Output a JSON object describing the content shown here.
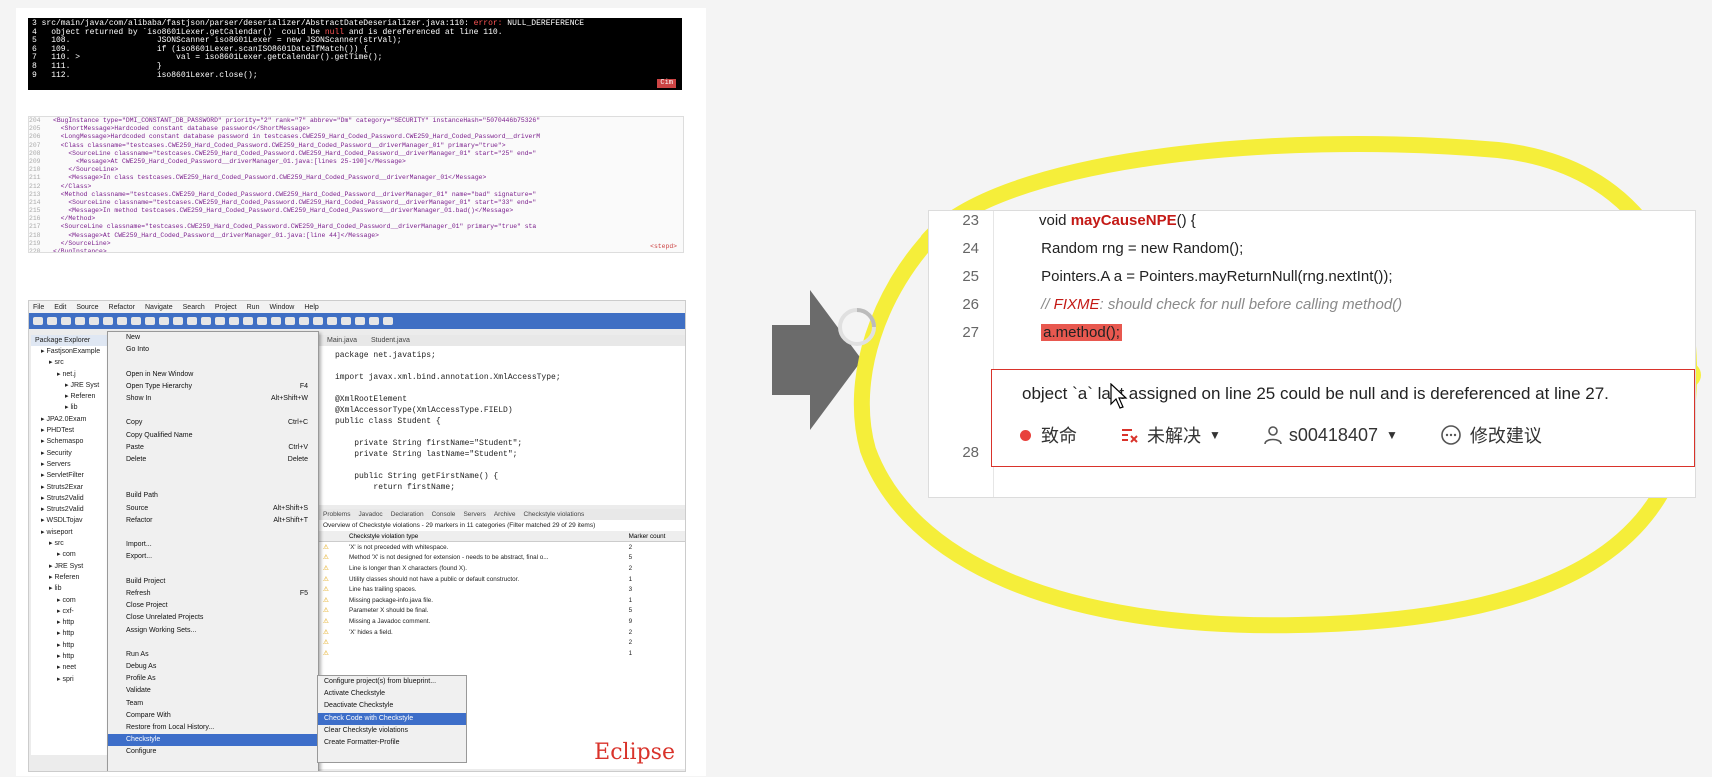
{
  "terminal": {
    "lines": [
      [
        "3",
        "src/main/java/com/alibaba/fastjson/parser/deserializer/AbstractDateDeserializer.java:110: ",
        "error:",
        " NULL_DEREFERENCE"
      ],
      [
        "4",
        "  object returned by `iso8601Lexer.getCalendar()` could be ",
        "null",
        " and is dereferenced at line 110."
      ],
      [
        "5",
        "  108.                  JSONScanner iso8601Lexer = new JSONScanner(strVal);",
        "",
        ""
      ],
      [
        "6",
        "  109.                  if (iso8601Lexer.scanISO8601DateIfMatch()) {",
        "",
        ""
      ],
      [
        "7",
        "  110. >                    val = iso8601Lexer.getCalendar().getTime();",
        "",
        ""
      ],
      [
        "8",
        "  111.                  }",
        "",
        ""
      ],
      [
        "9",
        "  112.                  iso8601Lexer.close();",
        "",
        ""
      ]
    ],
    "badge": "Cim"
  },
  "xml": {
    "lines": [
      [
        "204",
        "<BugInstance type=\"DMI_CONSTANT_DB_PASSWORD\" priority=\"2\" rank=\"7\" abbrev=\"Dm\" category=\"SECURITY\" instanceHash=\"5070446b75326\""
      ],
      [
        "205",
        "  <ShortMessage>Hardcoded constant database password</ShortMessage>"
      ],
      [
        "206",
        "  <LongMessage>Hardcoded constant database password in testcases.CWE259_Hard_Coded_Password.CWE259_Hard_Coded_Password__driverM"
      ],
      [
        "207",
        "  <Class classname=\"testcases.CWE259_Hard_Coded_Password.CWE259_Hard_Coded_Password__driverManager_01\" primary=\"true\">"
      ],
      [
        "208",
        "    <SourceLine classname=\"testcases.CWE259_Hard_Coded_Password.CWE259_Hard_Coded_Password__driverManager_01\" start=\"25\" end=\""
      ],
      [
        "209",
        "      <Message>At CWE259_Hard_Coded_Password__driverManager_01.java:[lines 25-190]</Message>"
      ],
      [
        "210",
        "    </SourceLine>"
      ],
      [
        "211",
        "    <Message>In class testcases.CWE259_Hard_Coded_Password.CWE259_Hard_Coded_Password__driverManager_01</Message>"
      ],
      [
        "212",
        "  </Class>"
      ],
      [
        "213",
        "  <Method classname=\"testcases.CWE259_Hard_Coded_Password.CWE259_Hard_Coded_Password__driverManager_01\" name=\"bad\" signature=\""
      ],
      [
        "214",
        "    <SourceLine classname=\"testcases.CWE259_Hard_Coded_Password.CWE259_Hard_Coded_Password__driverManager_01\" start=\"33\" end=\""
      ],
      [
        "215",
        "    <Message>In method testcases.CWE259_Hard_Coded_Password.CWE259_Hard_Coded_Password__driverManager_01.bad()</Message>"
      ],
      [
        "216",
        "  </Method>"
      ],
      [
        "217",
        "  <SourceLine classname=\"testcases.CWE259_Hard_Coded_Password.CWE259_Hard_Coded_Password__driverManager_01\" primary=\"true\" sta"
      ],
      [
        "218",
        "    <Message>At CWE259_Hard_Coded_Password__driverManager_01.java:[line 44]</Message>"
      ],
      [
        "219",
        "  </SourceLine>"
      ],
      [
        "220",
        "</BugInstance>"
      ]
    ],
    "trailing": "<stepd>"
  },
  "eclipse": {
    "menubar": [
      "File",
      "Edit",
      "Source",
      "Refactor",
      "Navigate",
      "Search",
      "Project",
      "Run",
      "Window",
      "Help"
    ],
    "package_explorer_title": "Package Explorer",
    "tree": [
      "FastjsonExample",
      "src",
      "net.j",
      "JRE Syst",
      "Referen",
      "lib",
      "JPA2.0Exam",
      "PHDTest",
      "Schemaspo",
      "Security",
      "Servers",
      "ServletFilter",
      "Struts2Exar",
      "Struts2Valid",
      "Struts2Valid",
      "WSDLTojav",
      "wiseport",
      "src",
      "com",
      "JRE Syst",
      "Referen",
      "lib",
      "com",
      "cxf-",
      "http",
      "http",
      "http",
      "http",
      "neet",
      "spri"
    ],
    "context_menu": [
      [
        "New",
        ""
      ],
      [
        "Go Into",
        ""
      ],
      [
        "",
        ""
      ],
      [
        "Open in New Window",
        ""
      ],
      [
        "Open Type Hierarchy",
        "F4"
      ],
      [
        "Show In",
        "Alt+Shift+W"
      ],
      [
        "",
        ""
      ],
      [
        "Copy",
        "Ctrl+C"
      ],
      [
        "Copy Qualified Name",
        ""
      ],
      [
        "Paste",
        "Ctrl+V"
      ],
      [
        "Delete",
        "Delete"
      ],
      [
        "",
        ""
      ],
      [
        "",
        ""
      ],
      [
        "Build Path",
        ""
      ],
      [
        "Source",
        "Alt+Shift+S"
      ],
      [
        "Refactor",
        "Alt+Shift+T"
      ],
      [
        "",
        ""
      ],
      [
        "Import...",
        ""
      ],
      [
        "Export...",
        ""
      ],
      [
        "",
        ""
      ],
      [
        "Build Project",
        ""
      ],
      [
        "Refresh",
        "F5"
      ],
      [
        "Close Project",
        ""
      ],
      [
        "Close Unrelated Projects",
        ""
      ],
      [
        "Assign Working Sets...",
        ""
      ],
      [
        "",
        ""
      ],
      [
        "Run As",
        ""
      ],
      [
        "Debug As",
        ""
      ],
      [
        "Profile As",
        ""
      ],
      [
        "Validate",
        ""
      ],
      [
        "Team",
        ""
      ],
      [
        "Compare With",
        ""
      ],
      [
        "Restore from Local History...",
        ""
      ],
      [
        "Checkstyle",
        ""
      ],
      [
        "Configure",
        ""
      ]
    ],
    "selected_menu": "Checkstyle",
    "submenu": [
      "Configure project(s) from blueprint...",
      "Activate Checkstyle",
      "Deactivate Checkstyle",
      "Check Code with Checkstyle",
      "Clear Checkstyle violations",
      "Create Formatter-Profile"
    ],
    "selected_submenu": "Check Code with Checkstyle",
    "editor_tabs": [
      "Main.java",
      "Student.java"
    ],
    "editor_lines": [
      "package net.javatips;",
      "",
      "import javax.xml.bind.annotation.XmlAccessType;",
      "",
      "@XmlRootElement",
      "@XmlAccessorType(XmlAccessType.FIELD)",
      "public class Student {",
      "",
      "    private String firstName=\"Student\";",
      "    private String lastName=\"Student\";",
      "",
      "    public String getFirstName() {",
      "        return firstName;"
    ],
    "view_tabs": [
      "Problems",
      "Javadoc",
      "Declaration",
      "Console",
      "Servers",
      "Archive",
      "Checkstyle violations"
    ],
    "overview": "Overview of Checkstyle violations - 29 markers in 11 categories (Filter matched 29 of 29 items)",
    "table_headers": [
      "Checkstyle violation type",
      "Marker count"
    ],
    "violations": [
      [
        "'X' is not preceded with whitespace.",
        "2"
      ],
      [
        "Method 'X' is not designed for extension - needs to be abstract, final o...",
        "5"
      ],
      [
        "Line is longer than X characters (found X).",
        "2"
      ],
      [
        "Utility classes should not have a public or default constructor.",
        "1"
      ],
      [
        "Line has trailing spaces.",
        "3"
      ],
      [
        "Missing package-info.java file.",
        "1"
      ],
      [
        "Parameter X should be final.",
        "5"
      ],
      [
        "Missing a Javadoc comment.",
        "9"
      ],
      [
        "'X' hides a field.",
        "2"
      ],
      [
        "",
        "2"
      ],
      [
        "",
        "1"
      ]
    ],
    "label": "Eclipse"
  },
  "code_view": {
    "lines": [
      {
        "num": "23",
        "parts": [
          [
            "",
            "void "
          ],
          [
            "fn",
            "mayCauseNPE"
          ],
          [
            "",
            "() {"
          ]
        ]
      },
      {
        "num": "24",
        "parts": [
          [
            "",
            " Random rng = new Random();"
          ]
        ]
      },
      {
        "num": "25",
        "parts": [
          [
            "",
            " Pointers.A a = Pointers.mayReturnNull(rng.nextInt());"
          ]
        ]
      },
      {
        "num": "26",
        "parts": [
          [
            "comment",
            " // "
          ],
          [
            "fixme",
            "FIXME"
          ],
          [
            "comment",
            ": should check for null before calling method()"
          ]
        ]
      },
      {
        "num": "27",
        "parts": [
          [
            "",
            " "
          ],
          [
            "err",
            "a.method();"
          ]
        ]
      },
      {
        "num": "28",
        "parts": [
          [
            "",
            " }"
          ]
        ]
      }
    ],
    "issue_message": "object `a` last assigned on line 25 could be null and is dereferenced at line 27.",
    "severity": "致命",
    "status": "未解决",
    "assignee": "s00418407",
    "suggest": "修改建议"
  },
  "colors": {
    "highlight": "#f5ee3a",
    "error": "#d9332b",
    "arrow": "#6b6b6b",
    "selection": "#3d6ec9"
  }
}
